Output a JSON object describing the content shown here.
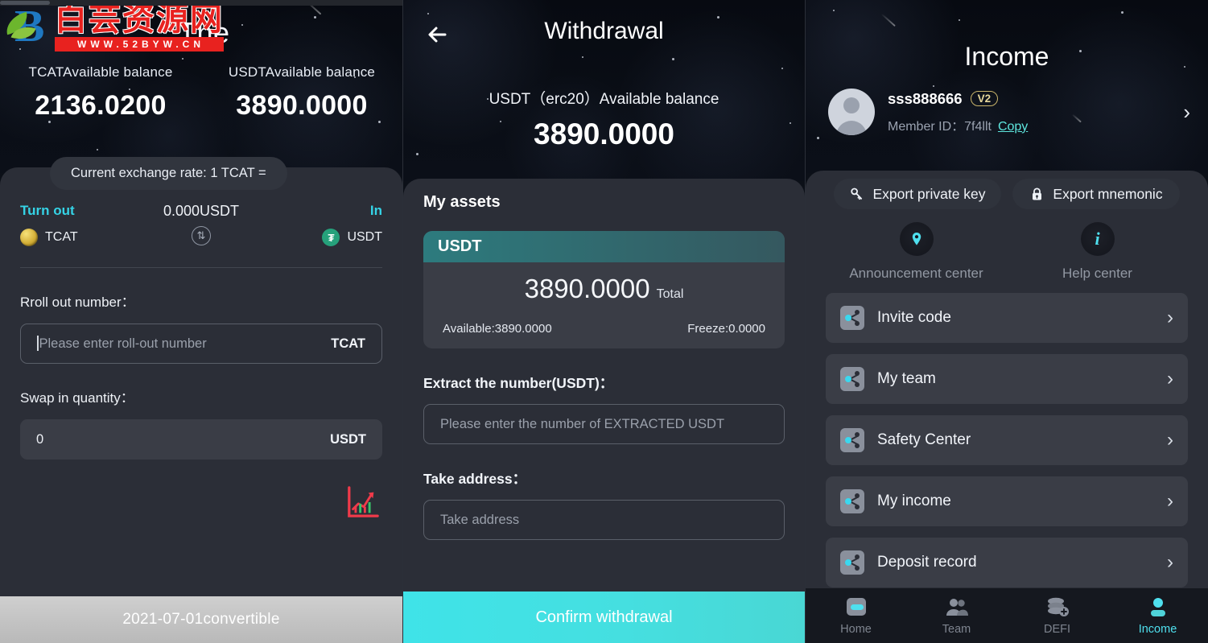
{
  "watermark": {
    "brand_cn": "白芸资源网",
    "url": "WWW.52BYW.CN",
    "logo_letter": "B"
  },
  "swap_panel": {
    "page_title": "The",
    "balances": [
      {
        "label": "TCATAvailable balance",
        "value": "2136.0200"
      },
      {
        "label": "USDTAvailable balance",
        "value": "3890.0000"
      }
    ],
    "exchange_rate": "Current exchange rate:  1 TCAT  =",
    "swap": {
      "out_tag": "Turn out",
      "out_coin": "TCAT",
      "in_tag": "In",
      "in_coin": "USDT",
      "mid_amount": "0.000USDT",
      "swap_icon": "swap-circle-icon"
    },
    "roll_out": {
      "label": "Rroll out number：",
      "placeholder": "Please enter roll-out number",
      "unit": "TCAT"
    },
    "swap_in": {
      "label": "Swap in quantity：",
      "value": "0",
      "unit": "USDT"
    },
    "chart_icon": "trend-chart-icon",
    "footer": "2021-07-01convertible",
    "accent": "#35d3e6"
  },
  "withdrawal_panel": {
    "back_icon": "back-arrow-icon",
    "title": "Withdrawal",
    "subtitle": "USDT（erc20）Available balance",
    "amount": "3890.0000",
    "section_title": "My assets",
    "asset_card": {
      "symbol": "USDT",
      "total_value": "3890.0000",
      "total_label": "Total",
      "available": "Available:3890.0000",
      "freeze": "Freeze:0.0000"
    },
    "extract": {
      "label": "Extract the number(USDT)：",
      "placeholder": "Please enter the number of EXTRACTED USDT"
    },
    "address": {
      "label": "Take address：",
      "placeholder": "Take address"
    },
    "cta": "Confirm withdrawal",
    "cta_color": "#45dfe0"
  },
  "income_panel": {
    "title": "Income",
    "user": {
      "avatar": "user-avatar-icon",
      "name": "sss888666",
      "level_badge": "V2",
      "member_id_label": "Member ID：",
      "member_id": "7f4llt",
      "copy_label": "Copy",
      "chevron": "chevron-right-icon"
    },
    "exports": [
      {
        "label": "Export private key",
        "icon": "key-icon"
      },
      {
        "label": "Export mnemonic",
        "icon": "lock-icon"
      }
    ],
    "quick_links": [
      {
        "label": "Announcement center",
        "icon": "location-pin-icon"
      },
      {
        "label": "Help center",
        "icon": "info-icon"
      }
    ],
    "menu": [
      {
        "label": "Invite code",
        "icon": "share-nodes-icon"
      },
      {
        "label": "My team",
        "icon": "share-nodes-icon"
      },
      {
        "label": "Safety Center",
        "icon": "share-nodes-icon"
      },
      {
        "label": "My income",
        "icon": "share-nodes-icon"
      },
      {
        "label": "Deposit record",
        "icon": "share-nodes-icon"
      }
    ],
    "tabbar": [
      {
        "label": "Home",
        "icon": "home-icon",
        "active": false
      },
      {
        "label": "Team",
        "icon": "team-icon",
        "active": false
      },
      {
        "label": "DEFI",
        "icon": "defi-coins-icon",
        "active": false
      },
      {
        "label": "Income",
        "icon": "person-icon",
        "active": true
      }
    ],
    "accent": "#4fe0ef"
  }
}
